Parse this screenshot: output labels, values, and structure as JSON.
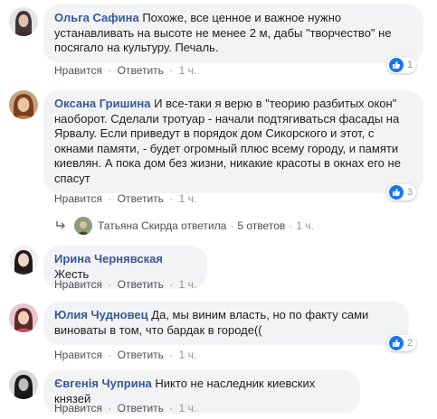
{
  "comments": [
    {
      "author": "Ольга Сафина",
      "text": "Похоже, все ценное и важное нужно устанавливать на высоте не менее 2 м, дабы \"творчество\" не посягало на культуру. Печаль.",
      "like_label": "Нравится",
      "reply_label": "Ответить",
      "time": "1 ч.",
      "reactions": "1"
    },
    {
      "author": "Оксана Гришина",
      "text": "И все-таки я верю в \"теорию разбитых окон\" наоборот. Сделали тротуар - начали подтягиваться фасады на Ярвалу. Если приведут в порядок дом Сикорского и этот, с окнами памяти, - будет огромный плюс всему городу, и памяти киевлян. А пока дом без жизни, никакие красоты в окнах его не спасут",
      "like_label": "Нравится",
      "reply_label": "Ответить",
      "time": "1 ч.",
      "reactions": "3",
      "reply_summary": {
        "name": "Татьяна Скирда ответила",
        "count": "5 ответов",
        "time": "1 ч."
      }
    },
    {
      "author": "Ирина Чернявская",
      "text": "Жесть",
      "like_label": "Нравится",
      "reply_label": "Ответить",
      "time": "1 ч."
    },
    {
      "author": "Юлия Чудновец",
      "text": "Да, мы виним власть, но по факту сами виноваты в том, что бардак в городе((",
      "like_label": "Нравится",
      "reply_label": "Ответить",
      "time": "1 ч.",
      "reactions": "2"
    },
    {
      "author": "Євгенія Чуприна",
      "text": "Никто не наследник киевских князей",
      "like_label": "Нравится",
      "reply_label": "Ответить",
      "time": "1 ч."
    }
  ],
  "separator": "·",
  "icons": {
    "like": "thumbs-up-icon",
    "reply_arrow": "reply-arrow-icon"
  },
  "colors": {
    "author": "#385898",
    "bubble": "#f2f3f5",
    "like": "#1877f2",
    "meta": "#90949c"
  }
}
